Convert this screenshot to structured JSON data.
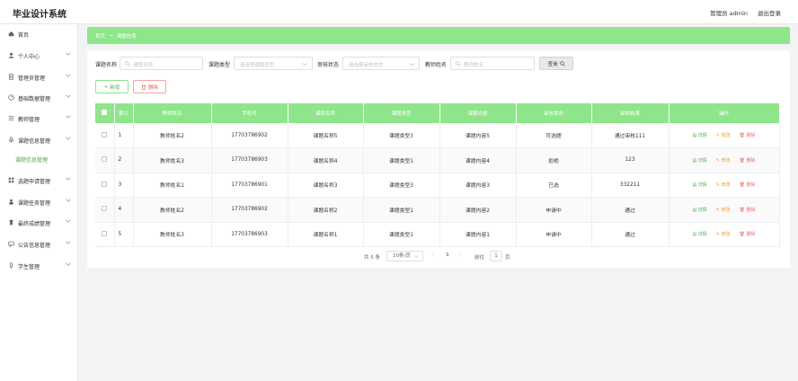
{
  "header": {
    "title": "毕业设计系统",
    "user": "管理员 admin",
    "logout": "退出登录"
  },
  "sidebar": {
    "items": [
      {
        "label": "首页",
        "icon": "home-icon",
        "expandable": false
      },
      {
        "label": "个人中心",
        "icon": "user-icon",
        "expandable": true
      },
      {
        "label": "管理员管理",
        "icon": "doc-icon",
        "expandable": true
      },
      {
        "label": "基础数据管理",
        "icon": "gauge-icon",
        "expandable": true
      },
      {
        "label": "教师管理",
        "icon": "list-icon",
        "expandable": true
      },
      {
        "label": "课题信息管理",
        "icon": "mic-icon",
        "expandable": true
      },
      {
        "label": "课题信息管理",
        "icon": "",
        "expandable": false,
        "sub": true
      },
      {
        "label": "选题申请管理",
        "icon": "grid-icon",
        "expandable": true
      },
      {
        "label": "课题任务管理",
        "icon": "person-icon",
        "expandable": true
      },
      {
        "label": "最终成绩管理",
        "icon": "medal-icon",
        "expandable": true
      },
      {
        "label": "公告信息管理",
        "icon": "chat-icon",
        "expandable": true
      },
      {
        "label": "学生管理",
        "icon": "pen-icon",
        "expandable": true
      }
    ]
  },
  "breadcrumb": {
    "home": "首页",
    "sep": "→",
    "current": "课题信息"
  },
  "search": {
    "fields": [
      {
        "label": "课题名称",
        "placeholder": "课题名称",
        "type": "text"
      },
      {
        "label": "课题类型",
        "placeholder": "请选择课题类型",
        "type": "select"
      },
      {
        "label": "审核状态",
        "placeholder": "请选择审核状态",
        "type": "select"
      },
      {
        "label": "教师姓名",
        "placeholder": "教师姓名",
        "type": "text"
      }
    ],
    "query_label": "查询"
  },
  "actions": {
    "add_label": "新增",
    "delete_label": "删除"
  },
  "table": {
    "headers": [
      "索引",
      "教师姓名",
      "手机号",
      "课题名称",
      "课题类型",
      "课题内容",
      "审核状态",
      "审核结果",
      "操作"
    ],
    "rows": [
      [
        "1",
        "教师姓名2",
        "17703786902",
        "课题名称5",
        "课题类型3",
        "课题内容5",
        "可选题",
        "通过审核111"
      ],
      [
        "2",
        "教师姓名3",
        "17703786903",
        "课题名称4",
        "课题类型1",
        "课题内容4",
        "拒绝",
        "123"
      ],
      [
        "3",
        "教师姓名1",
        "17703786901",
        "课题名称3",
        "课题类型3",
        "课题内容3",
        "已选",
        "332211"
      ],
      [
        "4",
        "教师姓名2",
        "17703786902",
        "课题名称2",
        "课题类型1",
        "课题内容2",
        "申请中",
        "通过"
      ],
      [
        "5",
        "教师姓名3",
        "17703786903",
        "课题名称1",
        "课题类型1",
        "课题内容1",
        "申请中",
        "通过"
      ]
    ],
    "ops": {
      "view": "详情",
      "edit": "修改",
      "delete": "删除"
    }
  },
  "pagination": {
    "total": "共 5 条",
    "page_size": "10条/页",
    "prev": "‹",
    "current": "1",
    "next": "›",
    "goto": "前往",
    "goto_value": "1",
    "page_word": "页"
  },
  "colors": {
    "accent": "#8ee58a",
    "accent_text": "#4caf50",
    "danger": "#f56c6c",
    "warning": "#e6a23c"
  }
}
